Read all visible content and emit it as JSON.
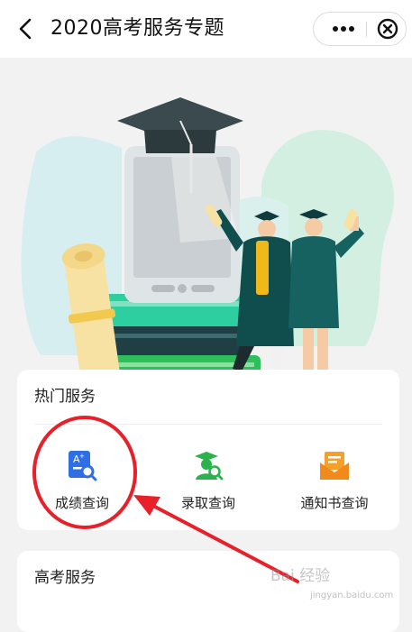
{
  "nav": {
    "title": "2020高考服务专题",
    "back_icon": "chevron-left-icon",
    "more_icon": "more-dots-icon",
    "close_icon": "close-circle-icon"
  },
  "hot_services": {
    "title": "热门服务",
    "items": [
      {
        "label": "成绩查询",
        "icon": "score-search-icon"
      },
      {
        "label": "录取查询",
        "icon": "graduate-search-icon"
      },
      {
        "label": "通知书查询",
        "icon": "envelope-icon"
      }
    ]
  },
  "gaokao_services": {
    "title": "高考服务"
  },
  "watermark": {
    "text": "Bai 经验",
    "url": "jingyan.baidu.com"
  },
  "colors": {
    "accent_blue": "#2f6fe4",
    "accent_green": "#2bb24c",
    "accent_orange": "#f5a02a",
    "annotation_red": "#e8202a"
  }
}
